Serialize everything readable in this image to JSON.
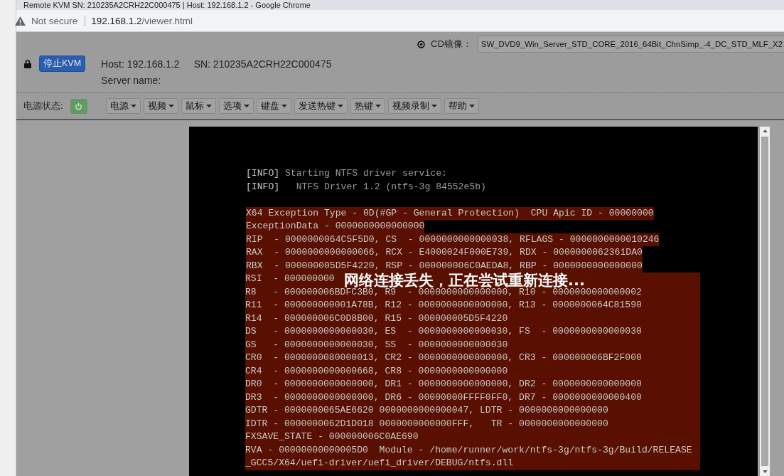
{
  "window": {
    "title": "Remote KVM SN: 210235A2CRH22C000475 | Host: 192.168.1.2 - Google Chrome"
  },
  "address_bar": {
    "security": "Not secure",
    "url_host": "192.168.1.2",
    "url_path": "/viewer.html"
  },
  "cd_image": {
    "label": "CD镜像：",
    "value": "SW_DVD9_Win_Server_STD_CORE_2016_64Bit_ChnSimp_-4_DC_STD_MLF_X2"
  },
  "header": {
    "stop_button": "停止KVM",
    "host": "Host: 192.168.1.2",
    "sn": "SN: 210235A2CRH22C000475",
    "server_name": "Server name:"
  },
  "toolbar": {
    "power_label": "电源状态:",
    "power_on": true,
    "menus": [
      "电源",
      "视频",
      "鼠标",
      "选项",
      "键盘",
      "发送热键",
      "热键",
      "视频录制",
      "帮助"
    ]
  },
  "console": {
    "info_lines": [
      {
        "tag": "[INFO]",
        "text": "Starting NTFS driver service:"
      },
      {
        "tag": "[INFO]",
        "text": "  NTFS Driver 1.2 (ntfs-3g 84552e5b)"
      }
    ],
    "exception_lines": [
      {
        "text": "X64 Exception Type - 0D(#GP - General Protection)  CPU Apic ID - 00000000",
        "highlight": true
      },
      {
        "text": "ExceptionData - 0000000000000000",
        "highlight": true
      },
      {
        "text": "RIP  - 0000000064C5F5D0, CS  - 0000000000000038, RFLAGS - 0000000000010246",
        "highlight": true
      },
      {
        "text": "RAX  - 0000000000000066, RCX - E4000024F000E739, RDX - 0000000062361DA0",
        "highlight": true
      },
      {
        "text": "RBX  - 000000005D5F4220, RSP - 000000006C0AEDA8, RBP - 0000000000000000",
        "highlight": true
      }
    ],
    "dump_lines": [
      "RSI  - 000000000",
      "R8   - 000000006BDFC3B0, R9  - 0000000000000000, R10 - 0000000000000002",
      "R11  - 000000000001A78B, R12 - 0000000000000000, R13 - 0000000064C81590",
      "R14  - 000000006C0D8B00, R15 - 000000005D5F4220",
      "DS   - 0000000000000030, ES  - 0000000000000030, FS  - 0000000000000030",
      "GS   - 0000000000000030, SS  - 0000000000000030",
      "CR0  - 0000000080000013, CR2 - 0000000000000000, CR3 - 000000006BF2F000",
      "CR4  - 0000000000000668, CR8 - 0000000000000000",
      "DR0  - 0000000000000000, DR1 - 0000000000000000, DR2 - 0000000000000000",
      "DR3  - 0000000000000000, DR6 - 00000000FFFF0FF0, DR7 - 0000000000000400",
      "GDTR - 0000000065AE6620 0000000000000047, LDTR - 0000000000000000",
      "IDTR - 0000000062D1D018 0000000000000FFF,   TR - 0000000000000000",
      "FXSAVE_STATE - 000000006C0AE690",
      "RVA - 00000000000005D0  Module - /home/runner/work/ntfs-3g/ntfs-3g/Build/RELEASE",
      "_GCC5/X64/uefi-driver/uefi_driver/DEBUG/ntfs.dll"
    ],
    "overlay": "网络连接丢失，正在尝试重新连接..."
  }
}
